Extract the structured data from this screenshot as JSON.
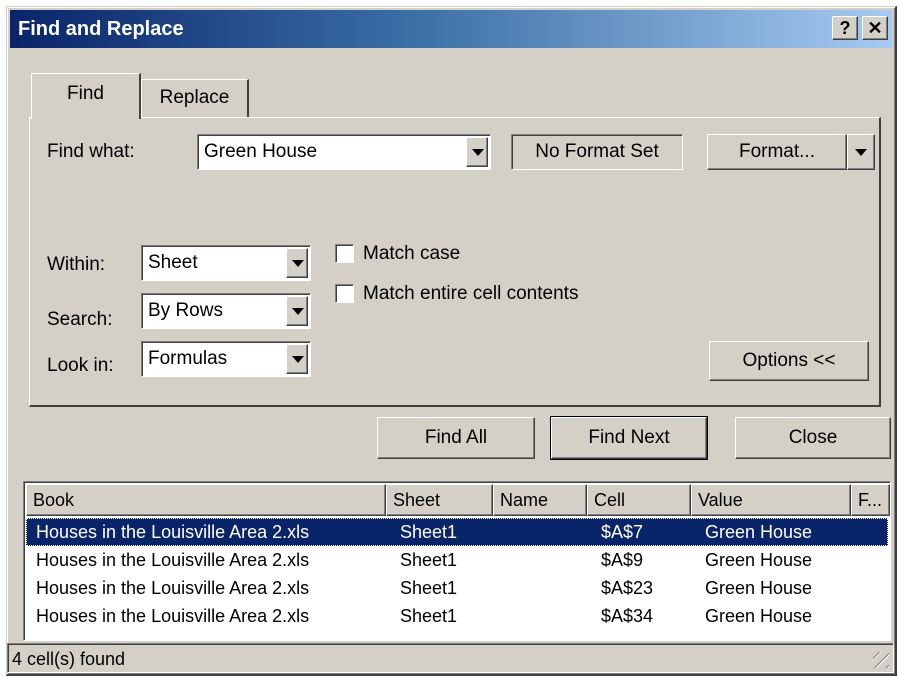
{
  "window": {
    "title": "Find and Replace",
    "help_label": "?",
    "close_label": "✕"
  },
  "tabs": [
    {
      "label": "Find",
      "active": true
    },
    {
      "label": "Replace",
      "active": false
    }
  ],
  "find_what": {
    "label": "Find what:",
    "value": "Green House"
  },
  "format_status": "No Format Set",
  "format_button": "Format...",
  "within": {
    "label": "Within:",
    "value": "Sheet"
  },
  "search": {
    "label": "Search:",
    "value": "By Rows"
  },
  "look_in": {
    "label": "Look in:",
    "value": "Formulas"
  },
  "match_case": {
    "label": "Match case",
    "checked": false
  },
  "match_entire": {
    "label": "Match entire cell contents",
    "checked": false
  },
  "options_button": "Options <<",
  "actions": {
    "find_all": "Find All",
    "find_next": "Find Next",
    "close": "Close"
  },
  "results": {
    "columns": [
      "Book",
      "Sheet",
      "Name",
      "Cell",
      "Value",
      "F..."
    ],
    "rows": [
      {
        "book": "Houses in the Louisville Area 2.xls",
        "sheet": "Sheet1",
        "name": "",
        "cell": "$A$7",
        "value": "Green House"
      },
      {
        "book": "Houses in the Louisville Area 2.xls",
        "sheet": "Sheet1",
        "name": "",
        "cell": "$A$9",
        "value": "Green House"
      },
      {
        "book": "Houses in the Louisville Area 2.xls",
        "sheet": "Sheet1",
        "name": "",
        "cell": "$A$23",
        "value": "Green House"
      },
      {
        "book": "Houses in the Louisville Area 2.xls",
        "sheet": "Sheet1",
        "name": "",
        "cell": "$A$34",
        "value": "Green House"
      }
    ],
    "selected_index": 0
  },
  "status_text": "4 cell(s) found",
  "colors": {
    "face": "#d4d0c8",
    "title_start": "#0a246a",
    "title_end": "#a6caf0",
    "selection": "#0a246a"
  }
}
